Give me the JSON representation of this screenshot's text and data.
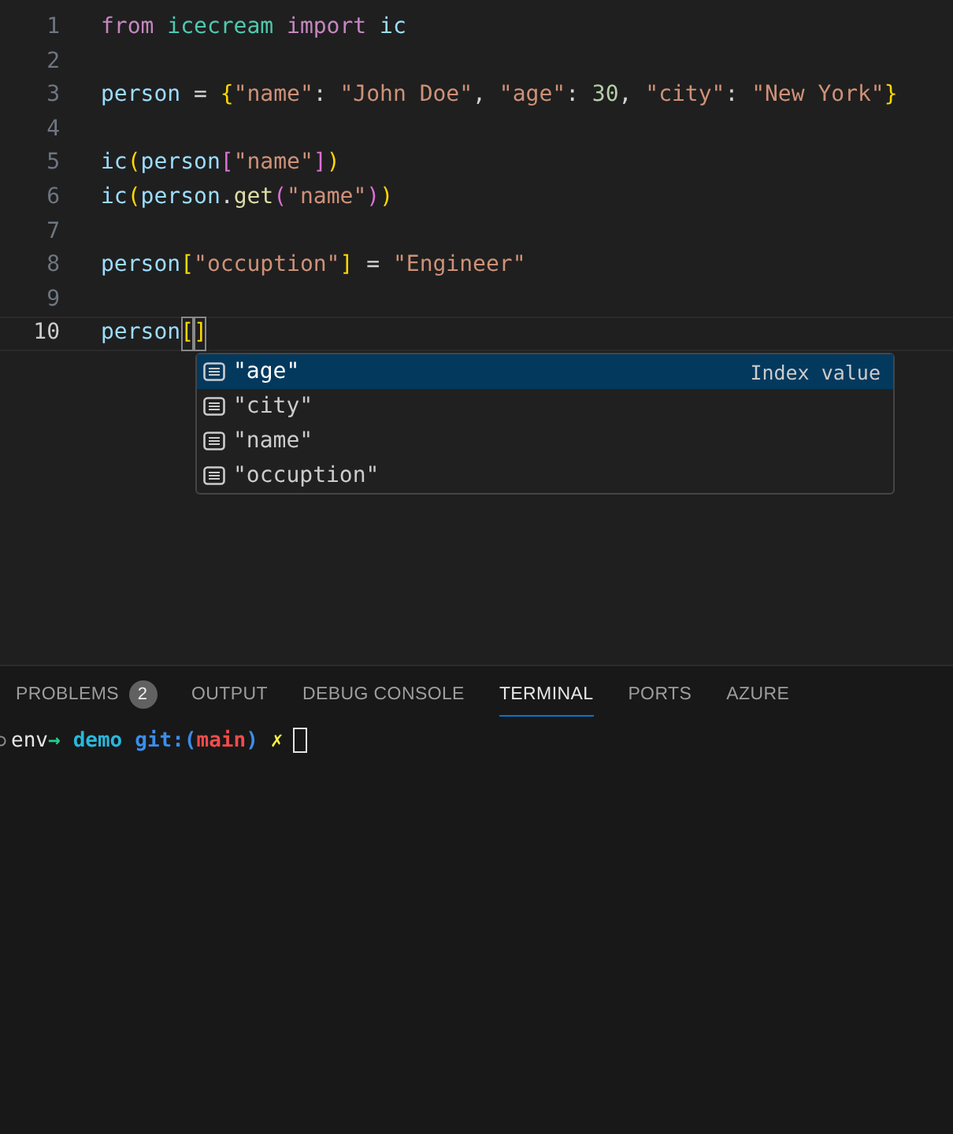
{
  "editor": {
    "lines": [
      {
        "number": "1",
        "active": false,
        "tokens": [
          {
            "text": "from ",
            "kind": "keyword"
          },
          {
            "text": "icecream ",
            "kind": "module"
          },
          {
            "text": "import ",
            "kind": "keyword"
          },
          {
            "text": "ic",
            "kind": "variable"
          }
        ]
      },
      {
        "number": "2",
        "active": false
      },
      {
        "number": "3",
        "active": false,
        "tokens": [
          {
            "text": "person",
            "kind": "variable"
          },
          {
            "text": " = ",
            "kind": "plain"
          },
          {
            "text": "{",
            "kind": "bracket1"
          },
          {
            "text": "\"name\"",
            "kind": "string"
          },
          {
            "text": ": ",
            "kind": "plain"
          },
          {
            "text": "\"John Doe\"",
            "kind": "string"
          },
          {
            "text": ", ",
            "kind": "plain"
          },
          {
            "text": "\"age\"",
            "kind": "string"
          },
          {
            "text": ": ",
            "kind": "plain"
          },
          {
            "text": "30",
            "kind": "number"
          },
          {
            "text": ", ",
            "kind": "plain"
          },
          {
            "text": "\"city\"",
            "kind": "string"
          },
          {
            "text": ": ",
            "kind": "plain"
          },
          {
            "text": "\"New York\"",
            "kind": "string"
          },
          {
            "text": "}",
            "kind": "bracket1"
          }
        ]
      },
      {
        "number": "4",
        "active": false
      },
      {
        "number": "5",
        "active": false,
        "tokens": [
          {
            "text": "ic",
            "kind": "variable"
          },
          {
            "text": "(",
            "kind": "bracket1"
          },
          {
            "text": "person",
            "kind": "variable"
          },
          {
            "text": "[",
            "kind": "bracket2"
          },
          {
            "text": "\"name\"",
            "kind": "string"
          },
          {
            "text": "]",
            "kind": "bracket2"
          },
          {
            "text": ")",
            "kind": "bracket1"
          }
        ]
      },
      {
        "number": "6",
        "active": false,
        "tokens": [
          {
            "text": "ic",
            "kind": "variable"
          },
          {
            "text": "(",
            "kind": "bracket1"
          },
          {
            "text": "person",
            "kind": "variable"
          },
          {
            "text": ".",
            "kind": "plain"
          },
          {
            "text": "get",
            "kind": "function"
          },
          {
            "text": "(",
            "kind": "bracket2"
          },
          {
            "text": "\"name\"",
            "kind": "string"
          },
          {
            "text": ")",
            "kind": "bracket2"
          },
          {
            "text": ")",
            "kind": "bracket1"
          }
        ]
      },
      {
        "number": "7",
        "active": false
      },
      {
        "number": "8",
        "active": false,
        "tokens": [
          {
            "text": "person",
            "kind": "variable"
          },
          {
            "text": "[",
            "kind": "bracket1"
          },
          {
            "text": "\"occuption\"",
            "kind": "string"
          },
          {
            "text": "]",
            "kind": "bracket1"
          },
          {
            "text": " = ",
            "kind": "plain"
          },
          {
            "text": "\"Engineer\"",
            "kind": "string"
          }
        ]
      },
      {
        "number": "9",
        "active": false
      },
      {
        "number": "10",
        "active": true,
        "tokens": [
          {
            "text": "person",
            "kind": "variable"
          },
          {
            "text": "[",
            "kind": "bracket_match"
          },
          {
            "text": "]",
            "kind": "bracket_match"
          }
        ]
      }
    ],
    "suggestions": [
      {
        "label": "\"age\"",
        "detail": "Index value",
        "selected": true
      },
      {
        "label": "\"city\"",
        "selected": false
      },
      {
        "label": "\"name\"",
        "selected": false
      },
      {
        "label": "\"occuption\"",
        "selected": false
      }
    ]
  },
  "panel": {
    "tabs": [
      {
        "label": "PROBLEMS",
        "badge": "2",
        "selected": false
      },
      {
        "label": "OUTPUT",
        "selected": false
      },
      {
        "label": "DEBUG CONSOLE",
        "selected": false
      },
      {
        "label": "TERMINAL",
        "selected": true
      },
      {
        "label": "PORTS",
        "selected": false
      },
      {
        "label": "AZURE",
        "selected": false
      }
    ],
    "terminal": {
      "prompt": [
        {
          "text": "env",
          "kind": "plain"
        },
        {
          "text": "→",
          "kind": "arrow"
        },
        {
          "text": "demo",
          "kind": "dir"
        },
        {
          "text": "git:(",
          "kind": "git"
        },
        {
          "text": "main",
          "kind": "branch"
        },
        {
          "text": ")",
          "kind": "git"
        },
        {
          "text": "✗",
          "kind": "dirty"
        }
      ]
    }
  }
}
